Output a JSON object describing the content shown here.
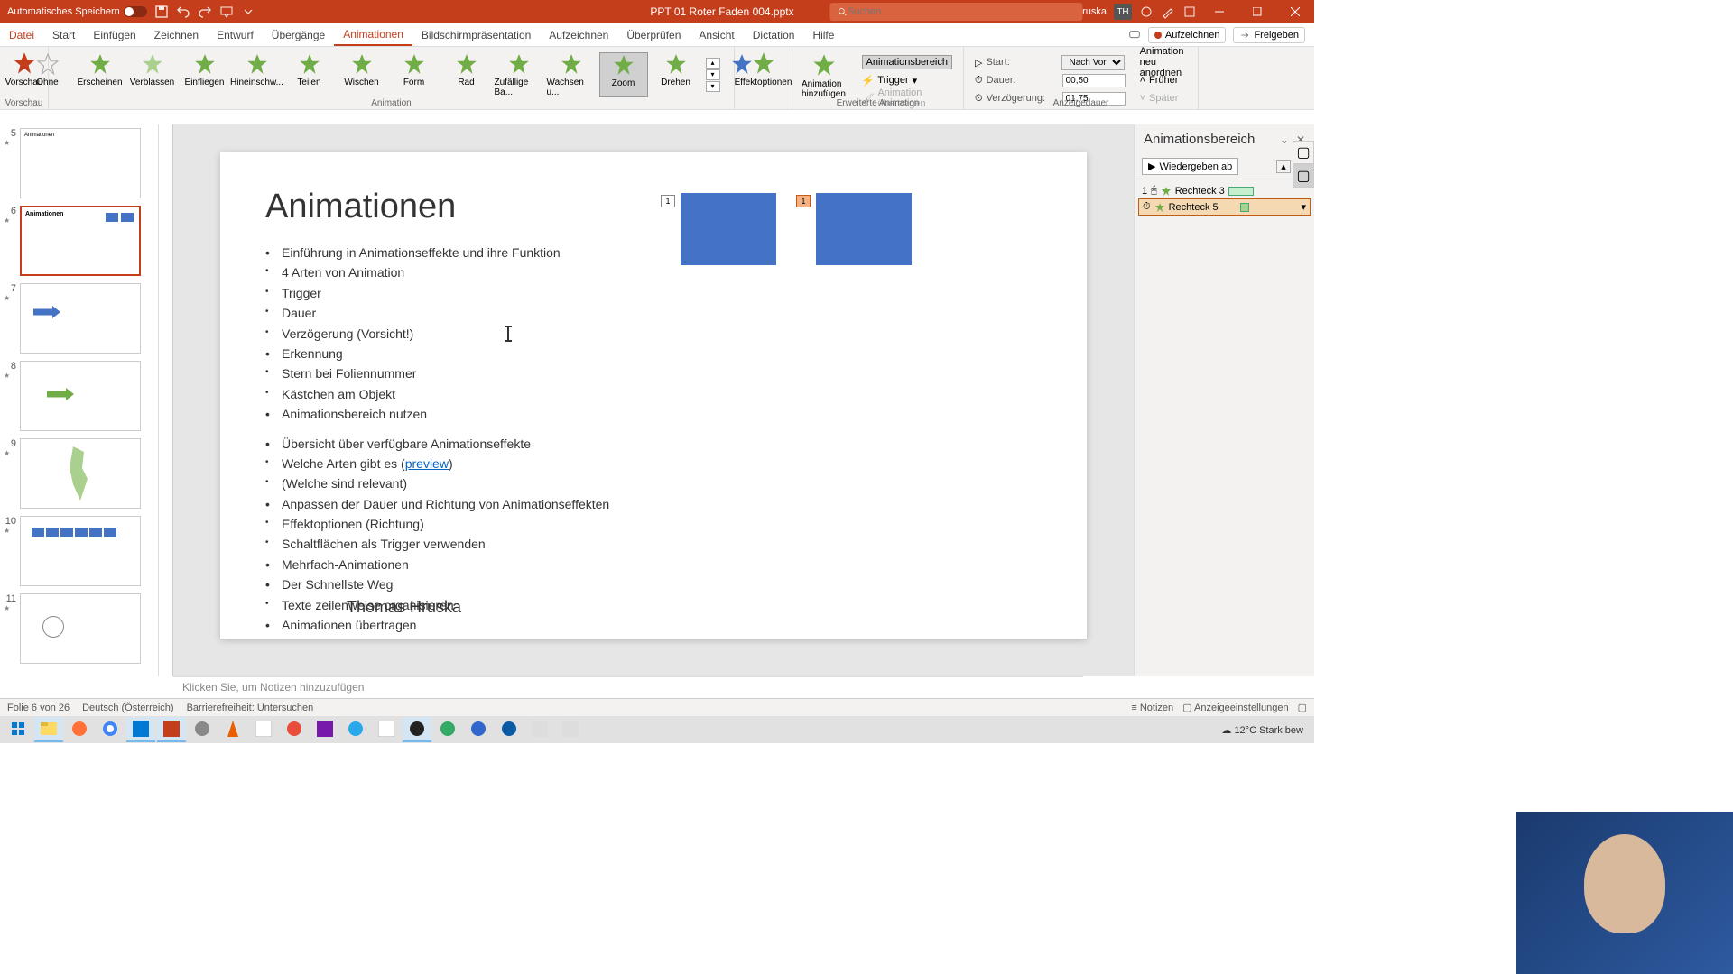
{
  "titleBar": {
    "autoSave": "Automatisches Speichern",
    "fileName": "PPT 01 Roter Faden 004.pptx",
    "searchPlaceholder": "Suchen",
    "userName": "Thomas Hruska",
    "userInitials": "TH"
  },
  "tabs": {
    "file": "Datei",
    "items": [
      "Start",
      "Einfügen",
      "Zeichnen",
      "Entwurf",
      "Übergänge",
      "Animationen",
      "Bildschirmpräsentation",
      "Aufzeichnen",
      "Überprüfen",
      "Ansicht",
      "Dictation",
      "Hilfe"
    ],
    "activeIndex": 5,
    "record": "Aufzeichnen",
    "share": "Freigeben"
  },
  "ribbon": {
    "preview": "Vorschau",
    "gallery": [
      "Ohne",
      "Erscheinen",
      "Verblassen",
      "Einfliegen",
      "Hineinschw...",
      "Teilen",
      "Wischen",
      "Form",
      "Rad",
      "Zufällige Ba...",
      "Wachsen u...",
      "Zoom",
      "Drehen"
    ],
    "selectedGalleryIndex": 11,
    "effectOptions": "Effektoptionen",
    "addAnim": "Animation hinzufügen",
    "animPaneBtn": "Animationsbereich",
    "trigger": "Trigger",
    "transfer": "Animation übertragen",
    "startLabel": "Start:",
    "startValue": "Nach Vorher...",
    "durationLabel": "Dauer:",
    "durationValue": "00,50",
    "delayLabel": "Verzögerung:",
    "delayValue": "01,75",
    "reorder": "Animation neu anordnen",
    "earlier": "Früher",
    "later": "Später",
    "groupAnimation": "Animation",
    "groupAdvanced": "Erweiterte Animation",
    "groupTiming": "Anzeigedauer"
  },
  "thumbs": [
    {
      "num": "5",
      "star": "★"
    },
    {
      "num": "6",
      "star": "★",
      "selected": true,
      "title": "Animationen"
    },
    {
      "num": "7",
      "star": "★"
    },
    {
      "num": "8",
      "star": "★"
    },
    {
      "num": "9",
      "star": "★"
    },
    {
      "num": "10",
      "star": "★"
    },
    {
      "num": "11",
      "star": "★"
    }
  ],
  "slide": {
    "title": "Animationen",
    "b1": "Einführung in Animationseffekte und ihre Funktion",
    "b1_1": "4 Arten von Animation",
    "b1_2": "Trigger",
    "b1_3": "Dauer",
    "b1_4": "Verzögerung (Vorsicht!)",
    "b2": "Erkennung",
    "b2_1": "Stern bei Foliennummer",
    "b2_2": "Kästchen am Objekt",
    "b3": "Animationsbereich nutzen",
    "b4": "Übersicht über verfügbare Animationseffekte",
    "b4_1a": "Welche Arten gibt es (",
    "b4_1link": "preview",
    "b4_1b": ")",
    "b4_2": "(Welche sind relevant)",
    "b5": "Anpassen der Dauer und Richtung von Animationseffekten",
    "b5_1": "Effektoptionen (Richtung)",
    "b5_2": "Schaltflächen als Trigger verwenden",
    "b6": "Mehrfach-Animationen",
    "b7": "Der Schnellste Weg",
    "b7_1": "Texte zeilenweise organisieren",
    "b8": "Animationen übertragen",
    "author": "Thomas Hruska",
    "tag1": "1",
    "tag2": "1"
  },
  "animPane": {
    "title": "Animationsbereich",
    "play": "Wiedergeben ab",
    "item1_num": "1",
    "item1": "Rechteck 3",
    "item2": "Rechteck 5"
  },
  "notes": {
    "placeholder": "Klicken Sie, um Notizen hinzuzufügen"
  },
  "status": {
    "slideInfo": "Folie 6 von 26",
    "lang": "Deutsch (Österreich)",
    "access": "Barrierefreiheit: Untersuchen",
    "notes": "Notizen",
    "display": "Anzeigeeinstellungen"
  },
  "taskbar": {
    "temp": "12°C",
    "weather": "Stark bew"
  }
}
